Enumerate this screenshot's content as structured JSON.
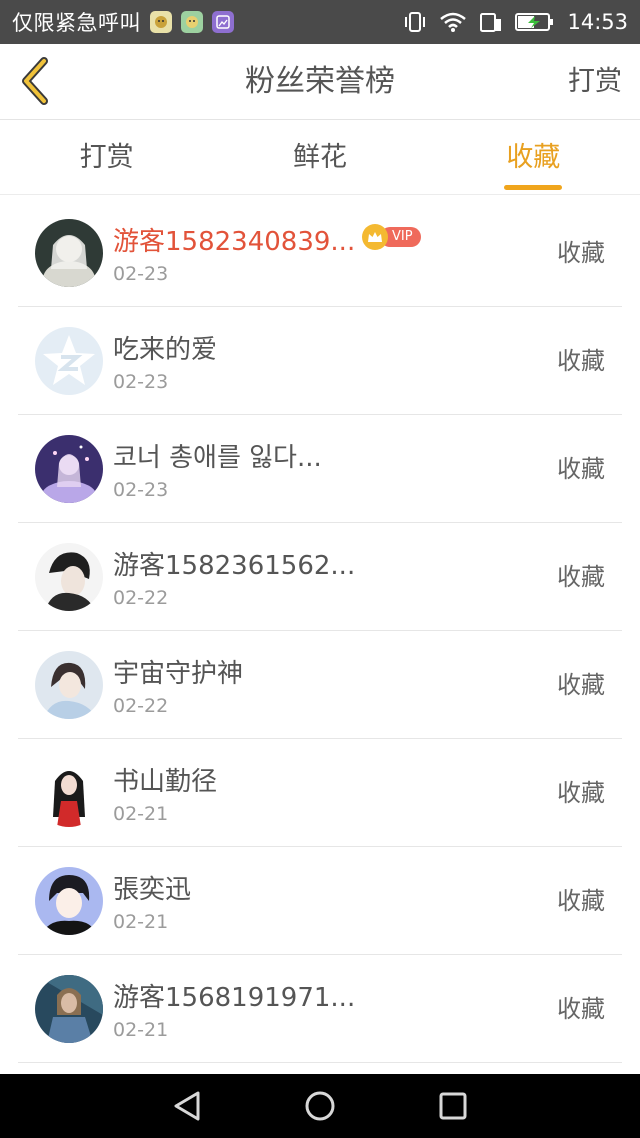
{
  "status_bar": {
    "notice": "仅限紧急呼叫",
    "time": "14:53",
    "icons": [
      "notification-app-icon",
      "notification-app-icon",
      "notification-gallery-icon",
      "vibrate-icon",
      "wifi-icon",
      "sim-icon",
      "battery-charging-icon"
    ]
  },
  "header": {
    "back_icon": "chevron-left-icon",
    "title": "粉丝荣誉榜",
    "action_label": "打赏"
  },
  "tabs": [
    {
      "label": "打赏",
      "active": false
    },
    {
      "label": "鲜花",
      "active": false
    },
    {
      "label": "收藏",
      "active": true
    }
  ],
  "list": [
    {
      "name": "游客1582340839...",
      "date": "02-23",
      "action": "收藏",
      "vip": true,
      "vip_label": "VIP"
    },
    {
      "name": "吃来的爱",
      "date": "02-23",
      "action": "收藏",
      "vip": false
    },
    {
      "name": "코너 총애를 잃다...",
      "date": "02-23",
      "action": "收藏",
      "vip": false
    },
    {
      "name": "游客1582361562...",
      "date": "02-22",
      "action": "收藏",
      "vip": false
    },
    {
      "name": "宇宙守护神",
      "date": "02-22",
      "action": "收藏",
      "vip": false
    },
    {
      "name": "书山勤径",
      "date": "02-21",
      "action": "收藏",
      "vip": false
    },
    {
      "name": "張奕迅",
      "date": "02-21",
      "action": "收藏",
      "vip": false
    },
    {
      "name": "游客1568191971...",
      "date": "02-21",
      "action": "收藏",
      "vip": false
    }
  ],
  "nav_bar": {
    "icons": [
      "back-triangle-icon",
      "home-circle-icon",
      "recents-square-icon"
    ]
  },
  "colors": {
    "accent": "#f0a51c",
    "vip_name": "#e2533a",
    "vip_badge": "#ef6a5b"
  }
}
